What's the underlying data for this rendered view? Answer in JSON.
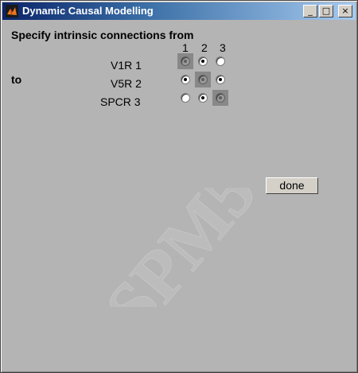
{
  "window": {
    "title": "Dynamic Causal Modelling",
    "minimize": "_",
    "maximize": "□",
    "close": "×"
  },
  "header": {
    "specify": "Specify intrinsic connections from",
    "to": "to"
  },
  "columns": [
    "1",
    "2",
    "3"
  ],
  "regions": [
    "V1R 1",
    "V5R 2",
    "SPCR 3"
  ],
  "matrix": [
    [
      true,
      true,
      false
    ],
    [
      true,
      true,
      true
    ],
    [
      false,
      true,
      true
    ]
  ],
  "done_button": "done",
  "watermark": "SPM5"
}
